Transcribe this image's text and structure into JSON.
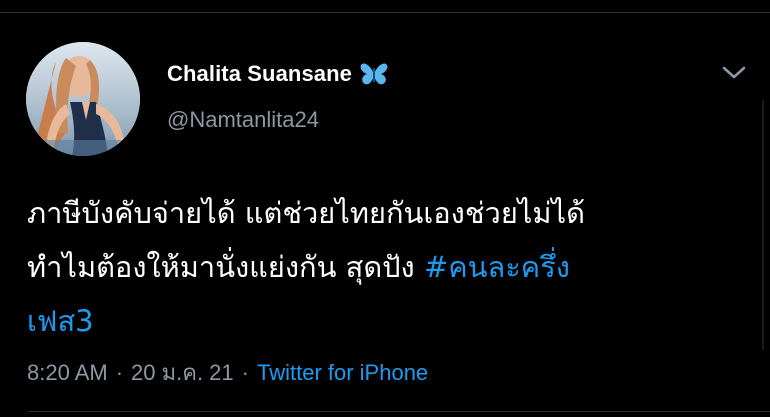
{
  "tweet": {
    "author": {
      "display_name": "Chalita Suansane",
      "handle": "@Namtanlita24",
      "badge_icon": "butterfly-icon",
      "avatar_icon": "profile-avatar"
    },
    "text": {
      "line1": "ภาษีบังคับจ่ายได้ แต่ช่วยไทยกันเองช่วยไม่ได้",
      "line2_prefix": "ทำไมต้องให้มานั่งแย่งกัน สุดปัง ",
      "hashtag": "#คนละครึ่ง",
      "line3_hashtag": "เฟส3"
    },
    "meta": {
      "time": "8:20 AM",
      "separator": "·",
      "date": "20 ม.ค. 21",
      "source": "Twitter for iPhone"
    },
    "menu_icon": "chevron-down-icon"
  },
  "colors": {
    "background": "#000000",
    "text": "#ffffff",
    "secondary": "#8b98a5",
    "link": "#1d9bf0",
    "divider": "#2f3336"
  }
}
